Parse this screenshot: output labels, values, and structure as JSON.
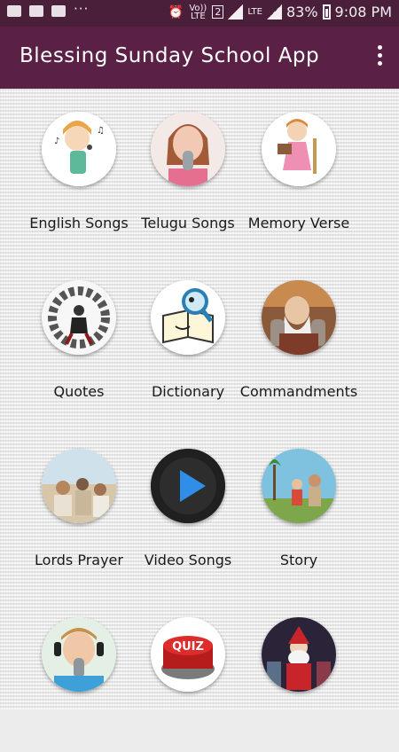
{
  "status_bar": {
    "network_badge": "2",
    "network_type": "LTE",
    "volte": "Vo)) LTE",
    "battery": "83%",
    "time": "9:08 PM"
  },
  "app_bar": {
    "title": "Blessing Sunday School App",
    "menu_icon": "more-vert-icon",
    "bg_color": "#5a2046"
  },
  "grid": {
    "items": [
      {
        "label": "English Songs",
        "icon": "girl-singing-icon"
      },
      {
        "label": "Telugu Songs",
        "icon": "girl-microphone-icon"
      },
      {
        "label": "Memory Verse",
        "icon": "girl-reading-icon"
      },
      {
        "label": "Quotes",
        "icon": "person-sitting-icon"
      },
      {
        "label": "Dictionary",
        "icon": "book-magnifier-icon"
      },
      {
        "label": "Commandments",
        "icon": "moses-tablets-icon"
      },
      {
        "label": "Lords Prayer",
        "icon": "jesus-teaching-icon"
      },
      {
        "label": "Video Songs",
        "icon": "play-button-icon"
      },
      {
        "label": "Story",
        "icon": "bible-story-icon"
      },
      {
        "label": "",
        "icon": "boy-singing-icon"
      },
      {
        "label": "",
        "icon": "quiz-button-icon"
      },
      {
        "label": "",
        "icon": "christmas-santa-icon"
      }
    ]
  }
}
